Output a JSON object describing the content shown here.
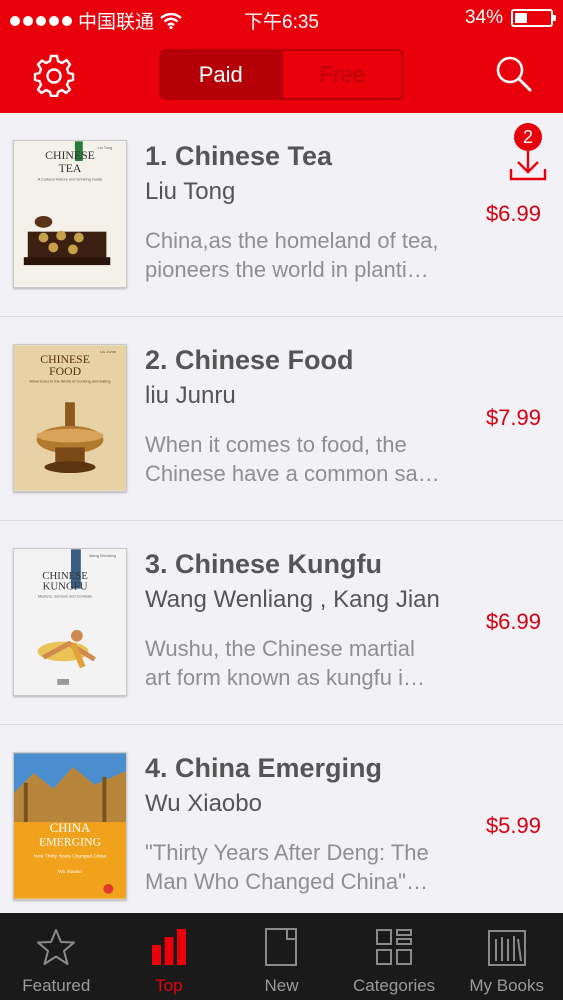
{
  "status_bar": {
    "carrier": "中国联通",
    "time": "下午6:35",
    "battery_percent": "34%",
    "battery_level": 0.34
  },
  "nav": {
    "segments": [
      "Paid",
      "Free"
    ],
    "selected_segment": "Paid",
    "icons": [
      "gear-icon",
      "search-icon"
    ]
  },
  "download": {
    "badge_count": "2",
    "icon": "download-icon"
  },
  "books": [
    {
      "title": "1. Chinese Tea",
      "author": "Liu Tong",
      "desc_line1": "China,as the homeland of tea,",
      "desc_line2": "pioneers the world in planti…",
      "price": "$6.99",
      "cover_title_1": "CHINESE",
      "cover_title_2": "TEA",
      "cover_subtitle": "A Cultural History and Drinking Guide",
      "cover_author": "Liu Tong",
      "cover_color": "#f4f1ea"
    },
    {
      "title": "2. Chinese Food",
      "author": "liu Junru",
      "desc_line1": "When it comes to food, the",
      "desc_line2": "Chinese have a common sa…",
      "price": "$7.99",
      "cover_title_1": "CHINESE",
      "cover_title_2": "FOOD",
      "cover_subtitle": "Adventures in the World of Cooking and Eating",
      "cover_author": "Liu Junru",
      "cover_color": "#e6d2a4"
    },
    {
      "title": "3. Chinese Kungfu",
      "author": "Wang Wenliang , Kang Jian",
      "desc_line1": "Wushu, the Chinese martial",
      "desc_line2": "art form known as kungfu i…",
      "price": "$6.99",
      "cover_title_1": "CHINESE",
      "cover_title_2": "KUNGFU",
      "cover_subtitle": "Masters, Schools and Combats",
      "cover_author": "Wang Wenliang",
      "cover_color": "#f3f3f3"
    },
    {
      "title": "4. China Emerging",
      "author": "Wu Xiaobo",
      "desc_line1": "\"Thirty Years After Deng: The",
      "desc_line2": "Man Who Changed China\"…",
      "price": "$5.99",
      "cover_title_1": "CHINA",
      "cover_title_2": "EMERGING",
      "cover_subtitle": "How Thirty Years Changed China",
      "cover_author": "Wu Xiaobo",
      "cover_color": "#f1a21c"
    }
  ],
  "tabs": [
    {
      "label": "Featured",
      "icon": "star-icon",
      "active": false
    },
    {
      "label": "Top",
      "icon": "bar-chart-icon",
      "active": true
    },
    {
      "label": "New",
      "icon": "new-book-icon",
      "active": false
    },
    {
      "label": "Categories",
      "icon": "grid-icon",
      "active": false
    },
    {
      "label": "My Books",
      "icon": "bookshelf-icon",
      "active": false
    }
  ],
  "colors": {
    "brand_red": "#e8000b",
    "segment_dark": "#b50007",
    "price_red": "#d60010",
    "tab_bar": "#1a1a1a"
  }
}
